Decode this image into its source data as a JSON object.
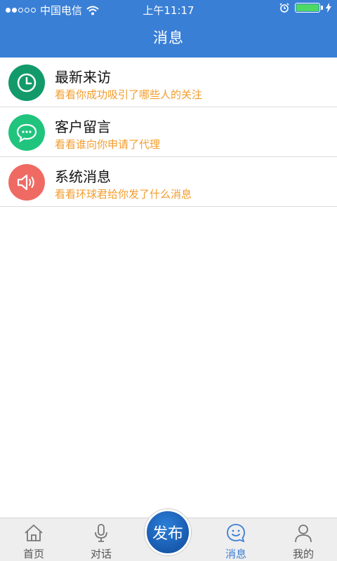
{
  "status_bar": {
    "carrier": "中国电信",
    "time": "上午11:17"
  },
  "header": {
    "title": "消息"
  },
  "messages": [
    {
      "title": "最新来访",
      "subtitle": "看看你成功吸引了哪些人的关注",
      "icon": "clock-icon",
      "color": "#129a6b"
    },
    {
      "title": "客户留言",
      "subtitle": "看看谁向你申请了代理",
      "icon": "chat-bubble-icon",
      "color": "#21c47d"
    },
    {
      "title": "系统消息",
      "subtitle": "看看环球君给你发了什么消息",
      "icon": "speaker-icon",
      "color": "#f06a64"
    }
  ],
  "tabbar": {
    "home": "首页",
    "talk": "对话",
    "publish": "发布",
    "messages": "消息",
    "mine": "我的",
    "active_color": "#3a7fd6"
  }
}
